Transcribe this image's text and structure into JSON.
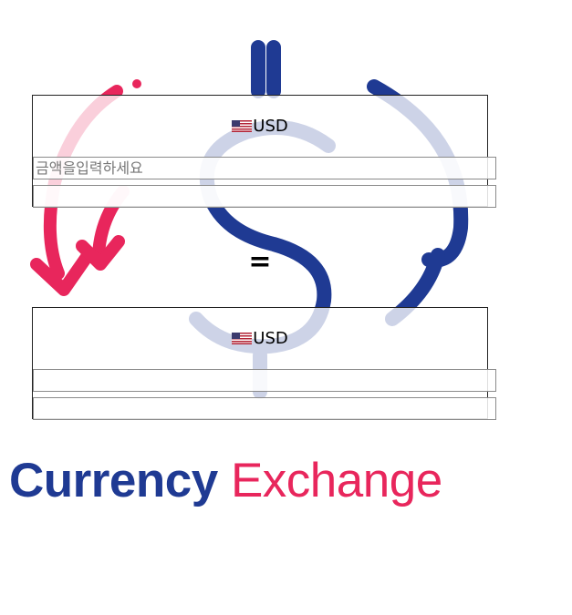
{
  "from": {
    "currency": "USD",
    "flag_icon": "us-flag-icon",
    "amount_placeholder": "금액을입력하세요",
    "amount_value": "",
    "result_value": ""
  },
  "equals_sign": "=",
  "to": {
    "currency": "USD",
    "flag_icon": "us-flag-icon",
    "amount_value": "",
    "result_value": ""
  },
  "brand": {
    "word1": "Currency",
    "word2": "Exchange"
  },
  "colors": {
    "brand_blue": "#1f3a93",
    "brand_pink": "#e8265c"
  }
}
